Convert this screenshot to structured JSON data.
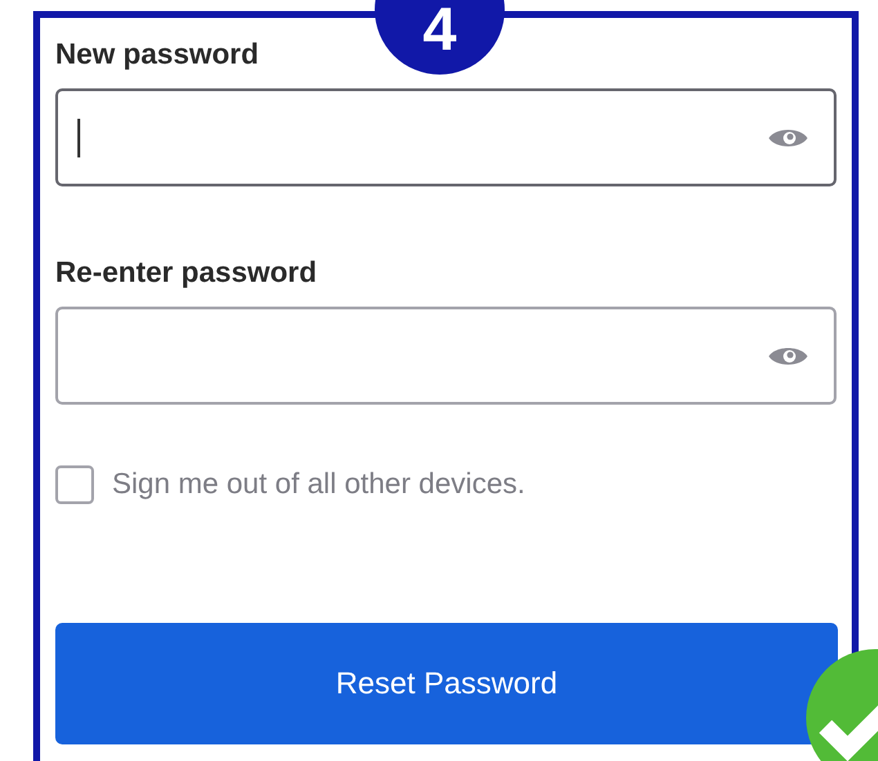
{
  "step_badge": "4",
  "fields": [
    {
      "label": "New password",
      "focused": true
    },
    {
      "label": "Re-enter password",
      "focused": false
    }
  ],
  "checkbox": {
    "label": "Sign me out of all other devices.",
    "checked": false
  },
  "button": "Reset Password",
  "done": true
}
